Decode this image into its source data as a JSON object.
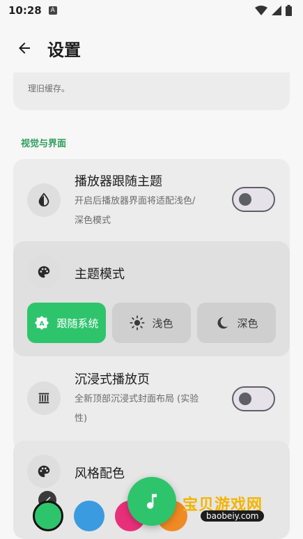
{
  "status_bar": {
    "time": "10:28",
    "app_icon_letter": "A"
  },
  "header": {
    "title": "设置"
  },
  "top_card": {
    "text": "理旧缓存。"
  },
  "section": {
    "title": "视觉与界面"
  },
  "rows": {
    "follow_theme": {
      "title": "播放器跟随主题",
      "subtitle_line1": "开启后播放器界面将适配浅色/",
      "subtitle_line2": "深色模式",
      "enabled": false
    },
    "theme_mode": {
      "title": "主题模式"
    },
    "immersive": {
      "title": "沉浸式播放页",
      "subtitle_line1": "全新顶部沉浸式封面布局 (实验",
      "subtitle_line2": "性)",
      "enabled": false
    },
    "style_color": {
      "title": "风格配色"
    }
  },
  "theme_modes": [
    {
      "label": "跟随系统",
      "icon": "auto-mode-icon",
      "selected": true
    },
    {
      "label": "浅色",
      "icon": "sun-icon",
      "selected": false
    },
    {
      "label": "深色",
      "icon": "moon-icon",
      "selected": false
    }
  ],
  "swatches": [
    "#2ec46c",
    "#3a9be0",
    "#e8307a",
    "#f08a24"
  ],
  "colors": {
    "accent": "#2ec46c",
    "card": "#ececec"
  },
  "watermark": {
    "text": "宝贝游戏网",
    "url": "baobeiy.com"
  }
}
